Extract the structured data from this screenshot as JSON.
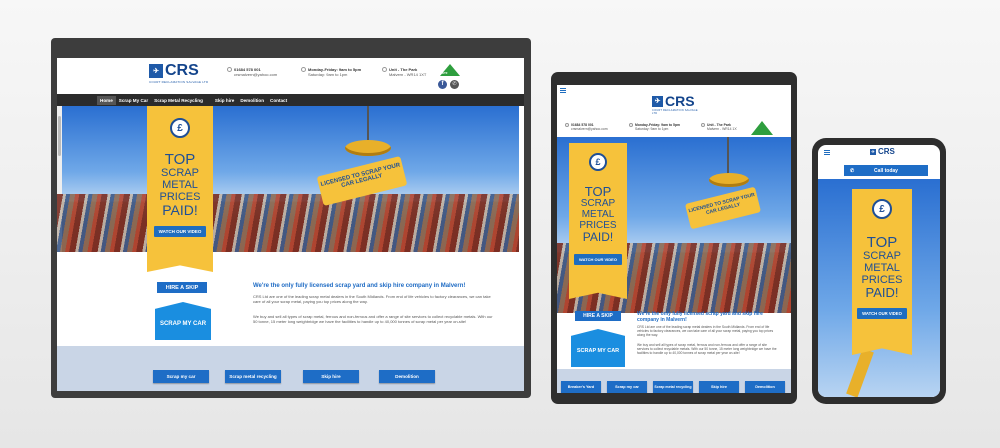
{
  "brand": {
    "logo_text": "CRS",
    "logo_sub": "COURT RECLAMATION SALVAGE LTD",
    "accent": "#1e6bc4",
    "yellow": "#f6c23b",
    "nav_bg": "#2b2b2b"
  },
  "header": {
    "phone": "01684 578 001",
    "email": "crsmalvern@yahoo.com",
    "hours_weekday": "Monday-Friday: 9am to 5pm",
    "hours_sat": "Saturday: 9am to 1pm",
    "address1": "Unit - The Park",
    "address2": "Malvern - WR14 1XT",
    "badge": "ATF"
  },
  "nav": [
    "Home",
    "Scrap My Car",
    "Scrap Metal Recycling",
    "Skip hire",
    "Demolition",
    "Contact"
  ],
  "hero": {
    "banner_line1": "TOP",
    "banner_line2": "SCRAP",
    "banner_line3": "METAL",
    "banner_line4": "PRICES",
    "banner_line5": "PAID!",
    "medal": "£",
    "video_btn": "WATCH OUR VIDEO",
    "sign": "LICENSED TO SCRAP YOUR CAR LEGALLY"
  },
  "cards": {
    "hire_skip": "HIRE A SKIP",
    "scrap_car": "SCRAP MY CAR"
  },
  "content": {
    "title": "We're the only fully licensed scrap yard and skip hire company in Malvern!",
    "p1": "CRS Ltd are one of the leading scrap metal dealers in the South Midlands. From end of life vehicles to factory clearances, we can take care of all your scrap metal, paying you top prices along the way.",
    "p2": "We buy and sell all types of scrap metal, ferrous and non-ferrous and offer a range of site services to collect recyclable metals. With our 50 tonne, 15 meter long weighbridge we have the facilities to handle up to 40,000 tonnes of scrap metal per year on-site!"
  },
  "footer_buttons": {
    "desktop": [
      "Scrap my car",
      "Scrap metal recycling",
      "Skip hire",
      "Demolition"
    ],
    "tablet": [
      "Breaker's Yard",
      "Scrap my car",
      "Scrap metal recycling",
      "Skip hire",
      "Demolition"
    ]
  },
  "phone": {
    "call_btn": "Call today"
  }
}
